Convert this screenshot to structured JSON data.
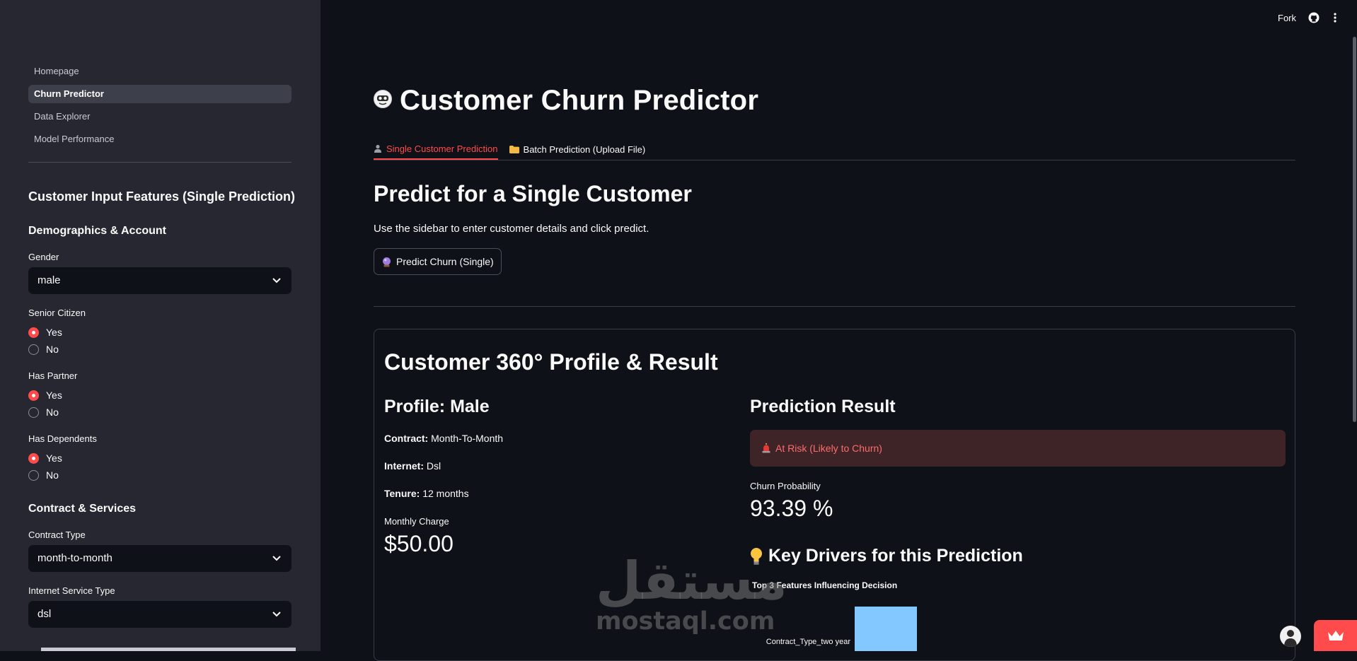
{
  "sidebar": {
    "nav": [
      "Homepage",
      "Churn Predictor",
      "Data Explorer",
      "Model Performance"
    ],
    "active_index": 1,
    "title": "Customer Input Features (Single Prediction)",
    "section_demographics": "Demographics & Account",
    "gender": {
      "label": "Gender",
      "value": "male"
    },
    "senior_citizen": {
      "label": "Senior Citizen",
      "options": [
        "Yes",
        "No"
      ],
      "selected": "Yes"
    },
    "has_partner": {
      "label": "Has Partner",
      "options": [
        "Yes",
        "No"
      ],
      "selected": "Yes"
    },
    "has_dependents": {
      "label": "Has Dependents",
      "options": [
        "Yes",
        "No"
      ],
      "selected": "Yes"
    },
    "section_contract": "Contract & Services",
    "contract_type": {
      "label": "Contract Type",
      "value": "month-to-month"
    },
    "internet_service": {
      "label": "Internet Service Type",
      "value": "dsl"
    }
  },
  "header": {
    "fork_label": "Fork"
  },
  "main": {
    "title": "Customer Churn Predictor",
    "tabs": [
      "Single Customer Prediction",
      "Batch Prediction (Upload File)"
    ],
    "active_tab": 0,
    "section_title": "Predict for a Single Customer",
    "instruction": "Use the sidebar to enter customer details and click predict.",
    "predict_button": "Predict Churn (Single)",
    "card": {
      "title": "Customer 360° Profile & Result",
      "profile_title": "Profile: Male",
      "contract_label": "Contract:",
      "contract_value": "Month-To-Month",
      "internet_label": "Internet:",
      "internet_value": "Dsl",
      "tenure_label": "Tenure:",
      "tenure_value": "12 months",
      "monthly_charge_label": "Monthly Charge",
      "monthly_charge_value": "$50.00",
      "prediction_title": "Prediction Result",
      "alert_text": "At Risk (Likely to Churn)",
      "churn_prob_label": "Churn Probability",
      "churn_prob_value": "93.39 %",
      "drivers_title": "Key Drivers for this Prediction",
      "chart_title": "Top 3 Features Influencing Decision"
    }
  },
  "colors": {
    "accent": "#ff4b4b",
    "bar": "#83c9ff",
    "alert_bg": "#3e2327"
  },
  "watermark": {
    "arabic": "مستقل",
    "latin": "mostaql.com"
  },
  "chart_data": {
    "type": "bar",
    "orientation": "horizontal",
    "title": "Top 3 Features Influencing Decision",
    "categories": [
      "Contract_Type_two year"
    ],
    "values": [
      1
    ],
    "note_visible_only": true
  }
}
